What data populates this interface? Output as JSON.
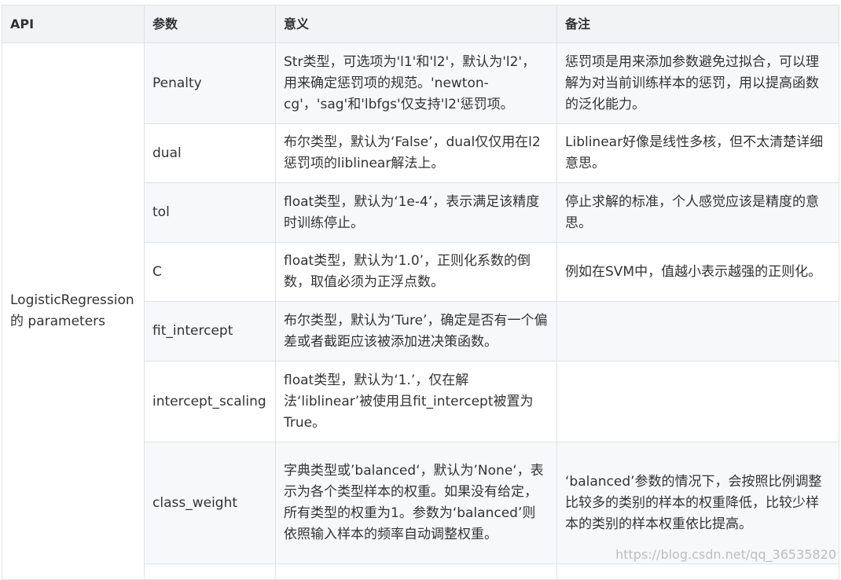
{
  "headers": [
    "API",
    "参数",
    "意义",
    "备注"
  ],
  "api_name": "LogisticRegression 的 parameters",
  "rows": [
    {
      "param": "Penalty",
      "meaning": "Str类型，可选项为'l1'和'l2'，默认为'l2'，用来确定惩罚项的规范。'newton-cg'，'sag'和'lbfgs'仅支持'l2'惩罚项。",
      "note": "惩罚项是用来添加参数避免过拟合，可以理解为对当前训练样本的惩罚，用以提高函数的泛化能力。"
    },
    {
      "param": "dual",
      "meaning": "布尔类型，默认为‘False’，dual仅仅用在l2惩罚项的liblinear解法上。",
      "note": "Liblinear好像是线性多核，但不太清楚详细意思。"
    },
    {
      "param": "tol",
      "meaning": "float类型，默认为‘1e-4’，表示满足该精度时训练停止。",
      "note": "停止求解的标准，个人感觉应该是精度的意思。"
    },
    {
      "param": "C",
      "meaning": "float类型，默认为‘1.0’，正则化系数的倒数，取值必须为正浮点数。",
      "note": "例如在SVM中，值越小表示越强的正则化。"
    },
    {
      "param": "fit_intercept",
      "meaning": "布尔类型，默认为‘Ture’，确定是否有一个偏差或者截距应该被添加进决策函数。",
      "note": ""
    },
    {
      "param": "intercept_scaling",
      "meaning": "float类型，默认为‘1.’，仅在解法‘liblinear’被使用且fit_intercept被置为True。",
      "note": ""
    },
    {
      "param": "class_weight",
      "meaning": "字典类型或’balanced‘，默认为’None‘，表示为各个类型样本的权重。如果没有给定，所有类型的权重为1。参数为‘balanced’则依照输入样本的频率自动调整权重。",
      "note": "‘balanced’参数的情况下，会按照比例调整比较多的类别的样本的权重降低，比较少样本的类别的样本权重依比提高。"
    }
  ],
  "watermark": "https://blog.csdn.net/qq_36535820"
}
